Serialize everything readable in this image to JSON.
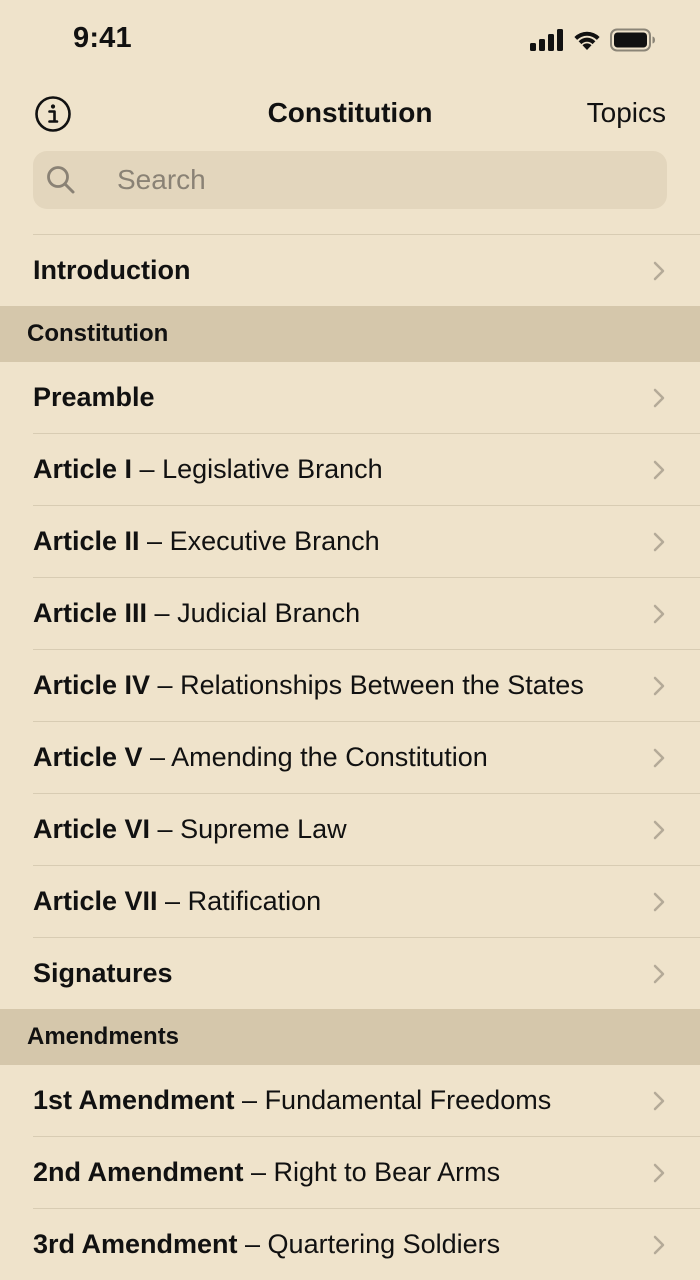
{
  "status_bar": {
    "time": "9:41",
    "signal_icon": "cellular-signal-icon",
    "wifi_icon": "wifi-icon",
    "battery_icon": "battery-icon"
  },
  "nav": {
    "info_icon": "info-icon",
    "title": "Constitution",
    "topics_label": "Topics"
  },
  "search": {
    "icon": "search-icon",
    "placeholder": "Search"
  },
  "intro": {
    "label": "Introduction"
  },
  "constitution_section": {
    "title": "Constitution",
    "items": [
      {
        "strong": "Preamble",
        "rest": ""
      },
      {
        "strong": "Article I",
        "rest": " – Legislative Branch"
      },
      {
        "strong": "Article II",
        "rest": " – Executive Branch"
      },
      {
        "strong": "Article III",
        "rest": " – Judicial Branch"
      },
      {
        "strong": "Article IV",
        "rest": " – Relationships Between the States"
      },
      {
        "strong": "Article V",
        "rest": " – Amending the Constitution"
      },
      {
        "strong": "Article VI",
        "rest": " – Supreme Law"
      },
      {
        "strong": "Article VII",
        "rest": " – Ratification"
      },
      {
        "strong": "Signatures",
        "rest": ""
      }
    ]
  },
  "amendments_section": {
    "title": "Amendments",
    "items": [
      {
        "strong": "1st Amendment",
        "rest": " – Fundamental Freedoms"
      },
      {
        "strong": "2nd Amendment",
        "rest": " – Right to Bear Arms"
      },
      {
        "strong": "3rd Amendment",
        "rest": " – Quartering Soldiers"
      }
    ]
  },
  "chevron_icon": "chevron-right-icon"
}
